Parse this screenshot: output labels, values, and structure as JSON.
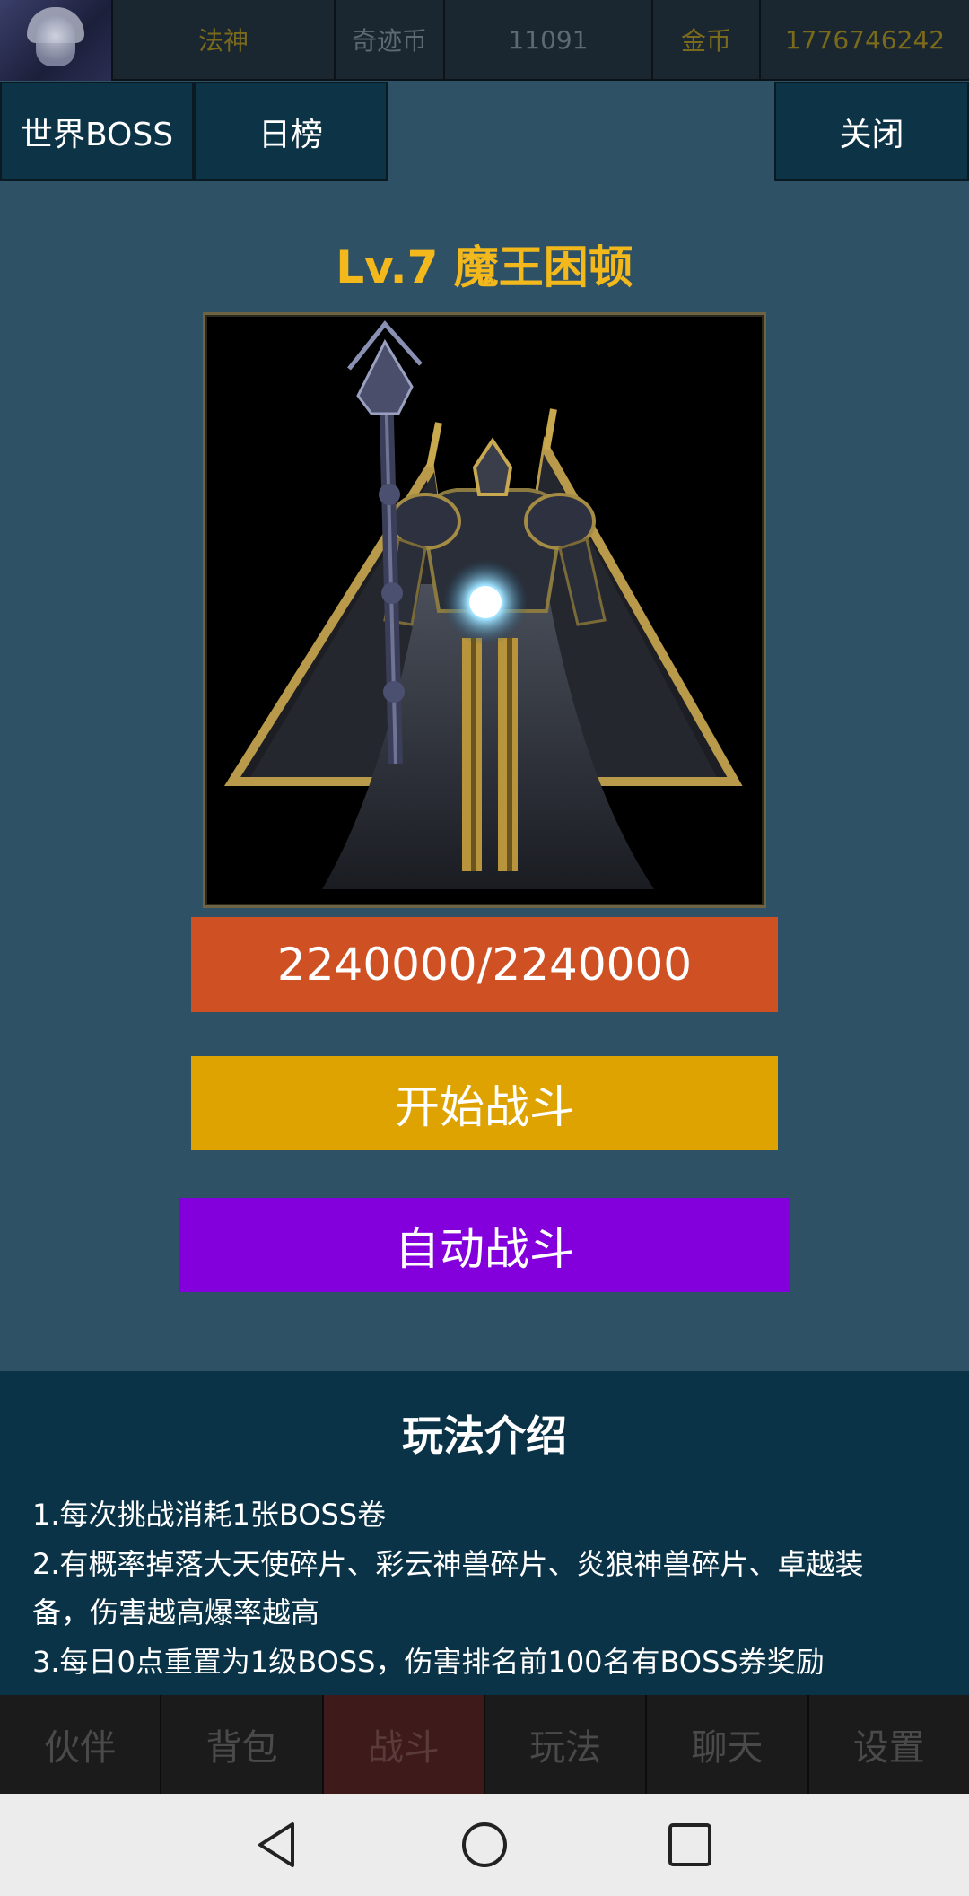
{
  "topbar": {
    "rank": "法神",
    "miracle_label": "奇迹币",
    "miracle_value": "11091",
    "gold_label": "金币",
    "gold_value": "1776746242"
  },
  "tabs": {
    "world_boss": "世界BOSS",
    "daily_rank": "日榜",
    "close": "关闭"
  },
  "boss": {
    "title": "Lv.7 魔王困顿",
    "hp_text": "2240000/2240000",
    "hp_current": 2240000,
    "hp_max": 2240000
  },
  "actions": {
    "start_fight": "开始战斗",
    "auto_fight": "自动战斗"
  },
  "intro": {
    "title": "玩法介绍",
    "lines": [
      "1.每次挑战消耗1张BOSS卷",
      "2.有概率掉落大天使碎片、彩云神兽碎片、炎狼神兽碎片、卓越装",
      "备，伤害越高爆率越高",
      "3.每日0点重置为1级BOSS，伤害排名前100名有BOSS券奖励"
    ]
  },
  "bottom_nav": {
    "items": [
      "伙伴",
      "背包",
      "战斗",
      "玩法",
      "聊天",
      "设置"
    ],
    "active": "战斗"
  },
  "colors": {
    "background": "#2f5166",
    "title_gold": "#f2b81c",
    "hp_bar": "#ce5023",
    "start_button": "#dea300",
    "auto_button": "#8300dd"
  }
}
